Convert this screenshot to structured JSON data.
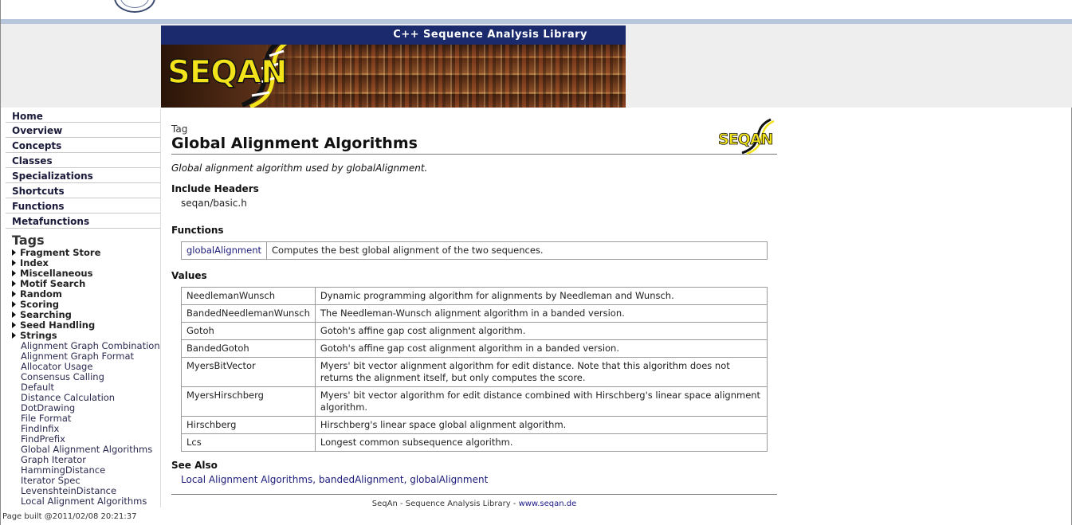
{
  "banner": {
    "library_title": "C++ Sequence Analysis Library",
    "logo_text": "SEQAN"
  },
  "nav": {
    "items": [
      {
        "label": "Home"
      },
      {
        "label": "Overview"
      },
      {
        "label": "Concepts"
      },
      {
        "label": "Classes"
      },
      {
        "label": "Specializations"
      },
      {
        "label": "Shortcuts"
      },
      {
        "label": "Functions"
      },
      {
        "label": "Metafunctions"
      }
    ]
  },
  "tags": {
    "title": "Tags",
    "folders": [
      {
        "label": "Fragment Store"
      },
      {
        "label": "Index"
      },
      {
        "label": "Miscellaneous"
      },
      {
        "label": "Motif Search"
      },
      {
        "label": "Random"
      },
      {
        "label": "Scoring"
      },
      {
        "label": "Searching"
      },
      {
        "label": "Seed Handling"
      },
      {
        "label": "Strings"
      }
    ],
    "leaves": [
      {
        "label": "Alignment Graph Combination"
      },
      {
        "label": "Alignment Graph Format"
      },
      {
        "label": "Allocator Usage"
      },
      {
        "label": "Consensus Calling"
      },
      {
        "label": "Default"
      },
      {
        "label": "Distance Calculation"
      },
      {
        "label": "DotDrawing"
      },
      {
        "label": "File Format"
      },
      {
        "label": "FindInfix"
      },
      {
        "label": "FindPrefix"
      },
      {
        "label": "Global Alignment Algorithms"
      },
      {
        "label": "Graph Iterator"
      },
      {
        "label": "HammingDistance"
      },
      {
        "label": "Iterator Spec"
      },
      {
        "label": "LevenshteinDistance"
      },
      {
        "label": "Local Alignment Algorithms"
      }
    ]
  },
  "page": {
    "kind": "Tag",
    "title": "Global Alignment Algorithms",
    "summary": "Global alignment algorithm used by globalAlignment.",
    "logo_text": "SEQAN",
    "include_heading": "Include Headers",
    "include_value": "seqan/basic.h",
    "functions_heading": "Functions",
    "functions": [
      {
        "name": "globalAlignment",
        "desc": "Computes the best global alignment of the two sequences."
      }
    ],
    "values_heading": "Values",
    "values": [
      {
        "name": "NeedlemanWunsch",
        "desc": "Dynamic programming algorithm for alignments by Needleman and Wunsch."
      },
      {
        "name": "BandedNeedlemanWunsch",
        "desc": "The Needleman-Wunsch alignment algorithm in a banded version."
      },
      {
        "name": "Gotoh",
        "desc": "Gotoh's affine gap cost alignment algorithm."
      },
      {
        "name": "BandedGotoh",
        "desc": "Gotoh's affine gap cost alignment algorithm in a banded version."
      },
      {
        "name": "MyersBitVector",
        "desc": "Myers' bit vector alignment algorithm for edit distance. Note that this algorithm does not returns the alignment itself, but only computes the score."
      },
      {
        "name": "MyersHirschberg",
        "desc": "Myers' bit vector algorithm for edit distance combined with Hirschberg's linear space alignment algorithm."
      },
      {
        "name": "Hirschberg",
        "desc": "Hirschberg's linear space global alignment algorithm."
      },
      {
        "name": "Lcs",
        "desc": "Longest common subsequence algorithm."
      }
    ],
    "see_also_heading": "See Also",
    "see_also": [
      {
        "label": "Local Alignment Algorithms"
      },
      {
        "label": "bandedAlignment"
      },
      {
        "label": "globalAlignment"
      }
    ],
    "see_also_sep": ", "
  },
  "footer": {
    "credit": "SeqAn - Sequence Analysis Library - ",
    "link": "www.seqan.de",
    "built": "Page built @2011/02/08 20:21:37"
  },
  "colors": {
    "banner_bar": "#1a2a6c",
    "logo_yellow": "#f2e31a",
    "link": "#1a1a7a"
  }
}
